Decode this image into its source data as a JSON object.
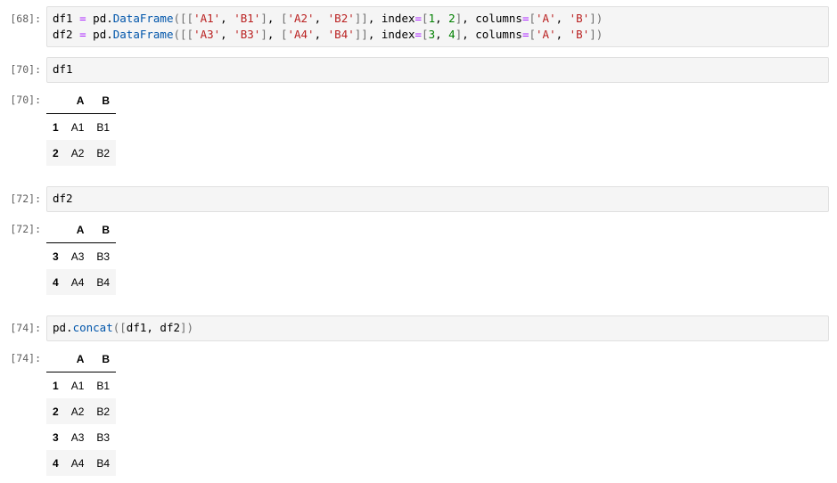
{
  "cells": [
    {
      "in_prompt": "[68]:",
      "code_lines": [
        [
          [
            "t-pun",
            "df1 "
          ],
          [
            "t-op",
            "="
          ],
          [
            "t-pun",
            " pd."
          ],
          [
            "t-fn",
            "DataFrame"
          ],
          [
            "t-brk",
            "([["
          ],
          [
            "t-str",
            "'A1'"
          ],
          [
            "t-pun",
            ", "
          ],
          [
            "t-str",
            "'B1'"
          ],
          [
            "t-brk",
            "]"
          ],
          [
            "t-pun",
            ", "
          ],
          [
            "t-brk",
            "["
          ],
          [
            "t-str",
            "'A2'"
          ],
          [
            "t-pun",
            ", "
          ],
          [
            "t-str",
            "'B2'"
          ],
          [
            "t-brk",
            "]]"
          ],
          [
            "t-pun",
            ", index"
          ],
          [
            "t-op",
            "="
          ],
          [
            "t-brk",
            "["
          ],
          [
            "t-num",
            "1"
          ],
          [
            "t-pun",
            ", "
          ],
          [
            "t-num",
            "2"
          ],
          [
            "t-brk",
            "]"
          ],
          [
            "t-pun",
            ", columns"
          ],
          [
            "t-op",
            "="
          ],
          [
            "t-brk",
            "["
          ],
          [
            "t-str",
            "'A'"
          ],
          [
            "t-pun",
            ", "
          ],
          [
            "t-str",
            "'B'"
          ],
          [
            "t-brk",
            "])"
          ]
        ],
        [
          [
            "t-pun",
            "df2 "
          ],
          [
            "t-op",
            "="
          ],
          [
            "t-pun",
            " pd."
          ],
          [
            "t-fn",
            "DataFrame"
          ],
          [
            "t-brk",
            "([["
          ],
          [
            "t-str",
            "'A3'"
          ],
          [
            "t-pun",
            ", "
          ],
          [
            "t-str",
            "'B3'"
          ],
          [
            "t-brk",
            "]"
          ],
          [
            "t-pun",
            ", "
          ],
          [
            "t-brk",
            "["
          ],
          [
            "t-str",
            "'A4'"
          ],
          [
            "t-pun",
            ", "
          ],
          [
            "t-str",
            "'B4'"
          ],
          [
            "t-brk",
            "]]"
          ],
          [
            "t-pun",
            ", index"
          ],
          [
            "t-op",
            "="
          ],
          [
            "t-brk",
            "["
          ],
          [
            "t-num",
            "3"
          ],
          [
            "t-pun",
            ", "
          ],
          [
            "t-num",
            "4"
          ],
          [
            "t-brk",
            "]"
          ],
          [
            "t-pun",
            ", columns"
          ],
          [
            "t-op",
            "="
          ],
          [
            "t-brk",
            "["
          ],
          [
            "t-str",
            "'A'"
          ],
          [
            "t-pun",
            ", "
          ],
          [
            "t-str",
            "'B'"
          ],
          [
            "t-brk",
            "])"
          ]
        ]
      ]
    },
    {
      "in_prompt": "[70]:",
      "code_lines": [
        [
          [
            "t-pun",
            "df1"
          ]
        ]
      ],
      "out_prompt": "[70]:",
      "table": {
        "columns": [
          "A",
          "B"
        ],
        "rows": [
          [
            "1",
            "A1",
            "B1"
          ],
          [
            "2",
            "A2",
            "B2"
          ]
        ]
      }
    },
    {
      "in_prompt": "[72]:",
      "code_lines": [
        [
          [
            "t-pun",
            "df2"
          ]
        ]
      ],
      "out_prompt": "[72]:",
      "table": {
        "columns": [
          "A",
          "B"
        ],
        "rows": [
          [
            "3",
            "A3",
            "B3"
          ],
          [
            "4",
            "A4",
            "B4"
          ]
        ]
      }
    },
    {
      "in_prompt": "[74]:",
      "code_lines": [
        [
          [
            "t-pun",
            "pd."
          ],
          [
            "t-fn",
            "concat"
          ],
          [
            "t-brk",
            "(["
          ],
          [
            "t-pun",
            "df1, df2"
          ],
          [
            "t-brk",
            "])"
          ]
        ]
      ],
      "out_prompt": "[74]:",
      "table": {
        "columns": [
          "A",
          "B"
        ],
        "rows": [
          [
            "1",
            "A1",
            "B1"
          ],
          [
            "2",
            "A2",
            "B2"
          ],
          [
            "3",
            "A3",
            "B3"
          ],
          [
            "4",
            "A4",
            "B4"
          ]
        ]
      }
    }
  ]
}
